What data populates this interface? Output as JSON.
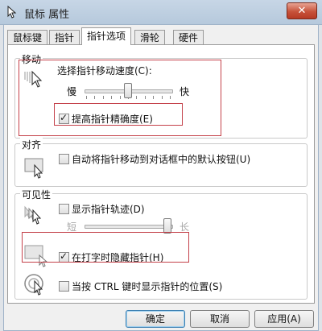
{
  "window": {
    "title": "鼠标 属性",
    "close_label": "✕"
  },
  "tabs": [
    {
      "label": "鼠标键"
    },
    {
      "label": "指针"
    },
    {
      "label": "指针选项"
    },
    {
      "label": "滑轮"
    },
    {
      "label": "硬件"
    }
  ],
  "motion": {
    "group_title": "移动",
    "speed_label": "选择指针移动速度(C):",
    "slow_label": "慢",
    "fast_label": "快",
    "speed_level": 0.5,
    "precision_label": "提高指针精确度(E)",
    "precision_checked": true
  },
  "snap_to": {
    "group_title": "对齐",
    "label": "自动将指针移动到对话框中的默认按钮(U)",
    "checked": false
  },
  "visibility": {
    "group_title": "可见性",
    "trails_label": "显示指针轨迹(D)",
    "trails_checked": false,
    "short_label": "短",
    "long_label": "长",
    "trail_level": 1.0,
    "hide_label": "在打字时隐藏指针(H)",
    "hide_checked": true,
    "ctrl_label": "当按 CTRL 键时显示指针的位置(S)",
    "ctrl_checked": false
  },
  "buttons": {
    "ok": "确定",
    "cancel": "取消",
    "apply": "应用(A)"
  }
}
